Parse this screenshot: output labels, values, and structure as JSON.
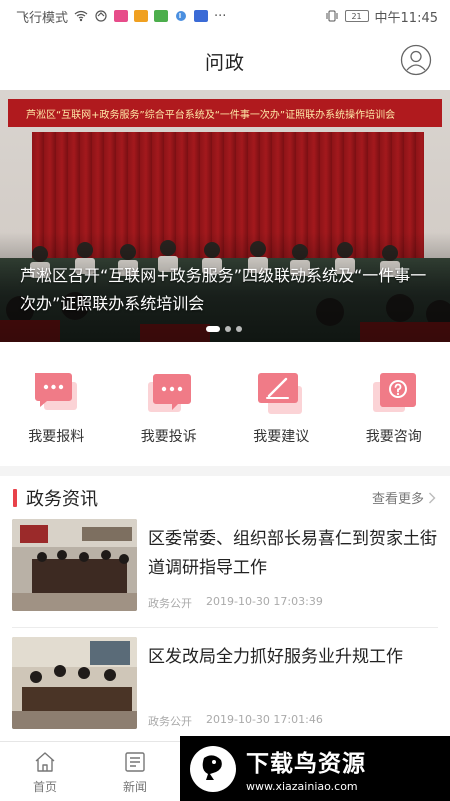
{
  "status_bar": {
    "left_text": "飞行模式",
    "more": "···",
    "battery": "21",
    "time": "中午11:45"
  },
  "header": {
    "title": "问政",
    "profile_icon": "user-circle-icon"
  },
  "banner": {
    "caption": "芦淞区召开“互联网+政务服务”四级联动系统及“一件事一次办”证照联办系统培训会",
    "strip_text": "芦淞区“互联网+政务服务”综合平台系统及“一件事一次办”证照联办系统操作培训会",
    "slide_count": 3,
    "active_slide": 1
  },
  "actions": [
    {
      "label": "我要报料",
      "icon": "chat-dots-icon"
    },
    {
      "label": "我要投诉",
      "icon": "complaint-icon"
    },
    {
      "label": "我要建议",
      "icon": "pen-suggest-icon"
    },
    {
      "label": "我要咨询",
      "icon": "question-icon"
    }
  ],
  "section": {
    "title": "政务资讯",
    "more_label": "查看更多"
  },
  "news": [
    {
      "title": "区委常委、组织部长易喜仁到贺家土街道调研指导工作",
      "category": "政务公开",
      "datetime": "2019-10-30 17:03:39"
    },
    {
      "title": "区发改局全力抓好服务业升规工作",
      "category": "政务公开",
      "datetime": "2019-10-30 17:01:46"
    }
  ],
  "tabs": [
    {
      "label": "首页",
      "icon": "home-icon"
    },
    {
      "label": "新闻",
      "icon": "news-icon"
    }
  ],
  "watermark": {
    "title": "下载鸟资源",
    "url": "www.xiazainiao.com"
  },
  "colors": {
    "accent": "#e8424a",
    "icon_pink": "#f07b87",
    "icon_bg": "#fbd3d6"
  }
}
